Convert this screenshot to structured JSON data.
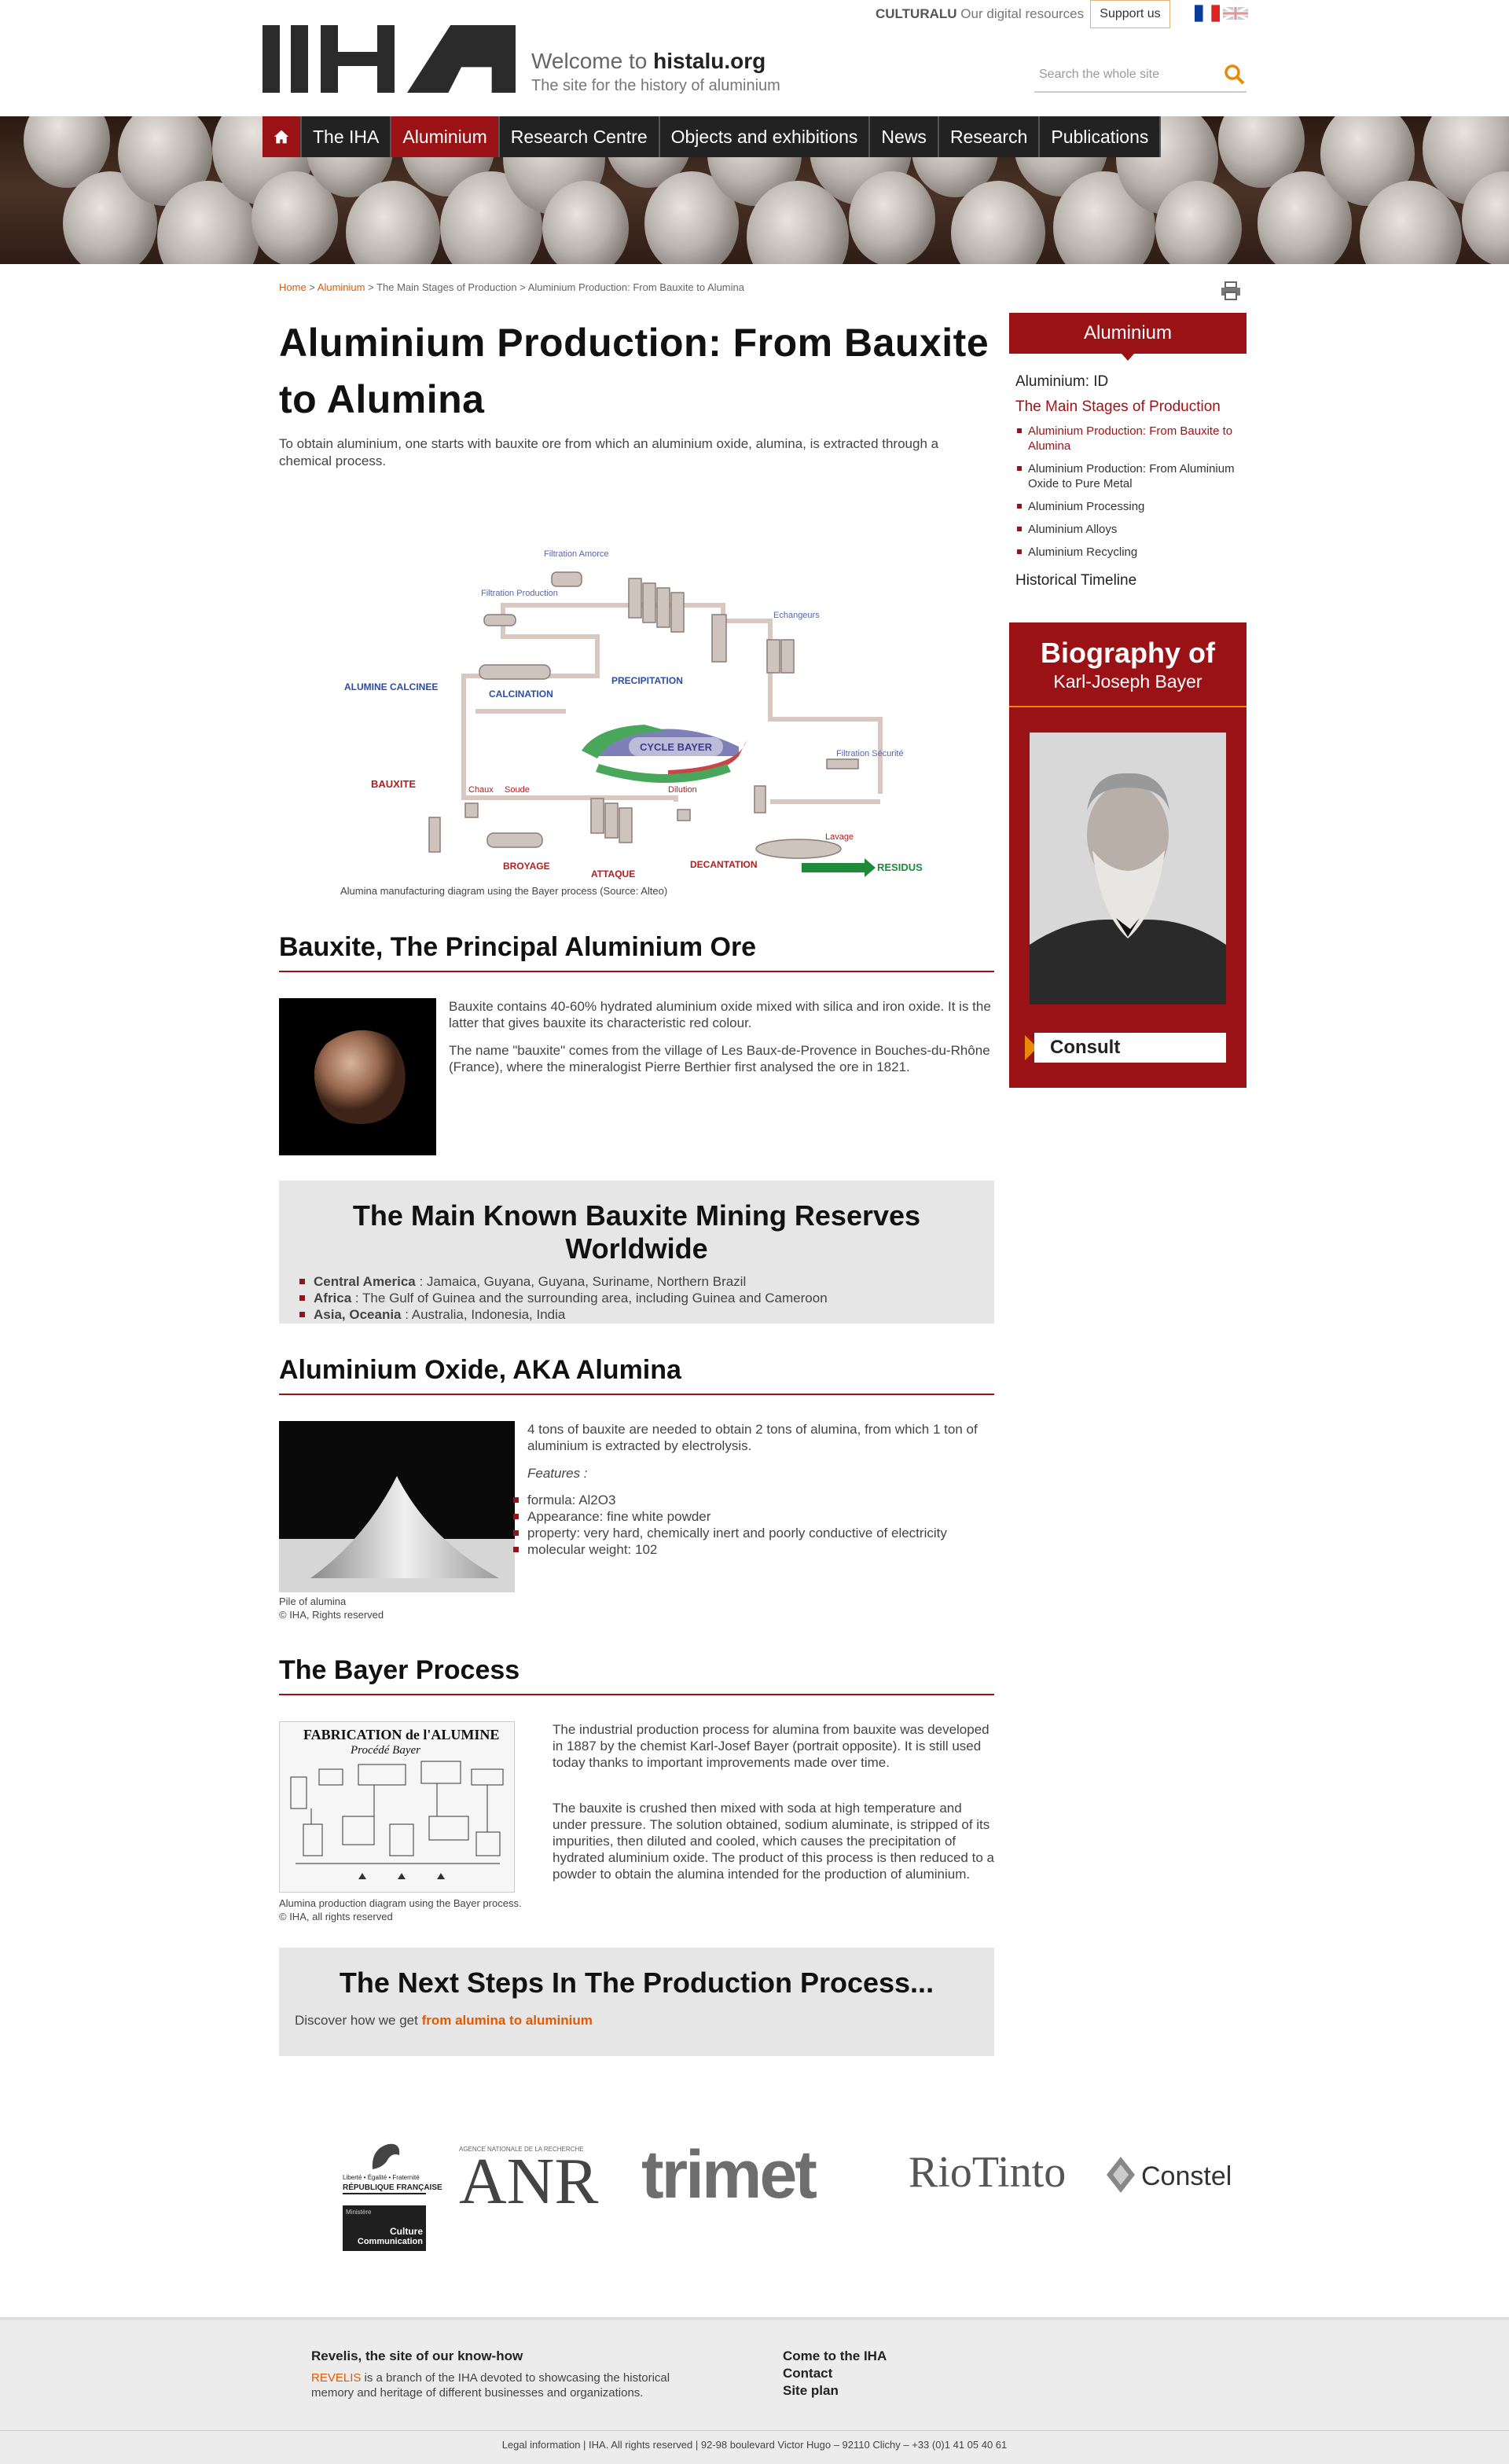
{
  "header": {
    "welcome_prefix": "Welcome to",
    "site_name": "histalu.org",
    "tagline": "The site for the history of aluminium",
    "culture_brand_bold": "CULTURALU",
    "culture_label": "Our digital resources",
    "support_label": "Support us",
    "search_placeholder": "Search the whole site",
    "flags": [
      "fr-flag",
      "uk-flag"
    ]
  },
  "nav": {
    "home_icon": "home-icon",
    "items": [
      "The IHA",
      "Aluminium",
      "Research Centre",
      "Objects and exhibitions",
      "News",
      "Research",
      "Publications"
    ],
    "active": "Aluminium"
  },
  "breadcrumb": {
    "home": "Home",
    "aluminium": "Aluminium",
    "stage": "The Main Stages of Production",
    "current": "Aluminium Production: From Bauxite to Alumina"
  },
  "page": {
    "title": "Aluminium Production: From Bauxite to Alumina",
    "intro": "To obtain aluminium, one starts with bauxite ore from which an aluminium oxide, alumina, is extracted through a chemical process.",
    "diagram_caption": "Alumina manufacturing diagram using the Bayer process (Source: Alteo)",
    "diagram_labels": {
      "filtration_amorce": "Filtration Amorce",
      "filtration_production": "Filtration Production",
      "echangeurs": "Echangeurs",
      "alumine": "ALUMINE CALCINEE",
      "calcination": "CALCINATION",
      "precipitation": "PRECIPITATION",
      "cycle": "CYCLE BAYER",
      "filtration_securite": "Filtration Sécurité",
      "bauxite": "BAUXITE",
      "chaux": "Chaux",
      "soude": "Soude",
      "dilution": "Dilution",
      "lavage": "Lavage",
      "broyage": "BROYAGE",
      "attaque": "ATTAQUE",
      "decantation": "DECANTATION",
      "residus": "RESIDUS"
    }
  },
  "bauxite_section": {
    "heading": "Bauxite, The Principal Aluminium Ore",
    "p1": "Bauxite contains 40-60% hydrated aluminium oxide mixed with silica and iron oxide. It is the latter that gives bauxite its characteristic red colour.",
    "p2": "The name \"bauxite\" comes from the village of Les Baux-de-Provence in Bouches-du-Rhône (France), where the mineralogist Pierre Berthier first analysed the ore in 1821."
  },
  "reserves_box": {
    "heading": "The Main Known Bauxite Mining Reserves Worldwide",
    "items": [
      {
        "region": "Central America",
        "places": " : Jamaica, Guyana, Guyana, Suriname, Northern Brazil"
      },
      {
        "region": "Africa",
        "places": " : The Gulf of Guinea and the surrounding area, including Guinea and Cameroon"
      },
      {
        "region": "Asia, Oceania",
        "places": " : Australia, Indonesia, India"
      }
    ]
  },
  "alumina_section": {
    "heading": "Aluminium Oxide, AKA Alumina",
    "p1": "4 tons of bauxite are needed to obtain 2 tons of alumina, from which 1 ton of aluminium is extracted by electrolysis.",
    "features_label": "Features :",
    "features": [
      "formula: Al2O3",
      "Appearance: fine white powder",
      "property: very hard, chemically inert and poorly conductive of electricity",
      "molecular weight: 102"
    ],
    "img_caption_1": "Pile of alumina",
    "img_caption_2": "© IHA, Rights reserved"
  },
  "bayer_section": {
    "heading": "The Bayer Process",
    "img_title_1": "FABRICATION de l'ALUMINE",
    "img_title_2": "Procédé Bayer",
    "p1": "The industrial production process for alumina from bauxite was developed in 1887 by the chemist Karl-Josef Bayer (portrait opposite). It is still used today thanks to important improvements made over time.",
    "p2": "The bauxite is crushed then mixed with soda at high temperature and under pressure. The solution obtained, sodium aluminate, is stripped of its impurities, then diluted and cooled, which causes the precipitation of hydrated aluminium oxide. The product of this process is then reduced to a powder to obtain the alumina intended for the production of aluminium.",
    "img_caption_1": "Alumina production diagram using the Bayer process.",
    "img_caption_2": "© IHA, all rights reserved"
  },
  "next_box": {
    "heading": "The Next Steps In The Production Process...",
    "text": "Discover how we get ",
    "link": "from alumina to aluminium"
  },
  "sidebar": {
    "heading": "Aluminium",
    "l1_id": "Aluminium: ID",
    "l1_stages": "The Main Stages of Production",
    "sub": [
      "Aluminium Production: From Bauxite to Alumina",
      "Aluminium Production: From Aluminium Oxide to Pure Metal",
      "Aluminium Processing",
      "Aluminium Alloys",
      "Aluminium Recycling"
    ],
    "timeline": "Historical Timeline",
    "bio_title": "Biography of",
    "bio_name": "Karl-Joseph Bayer",
    "consult": "Consult"
  },
  "sponsors": {
    "rf_top": "Liberté • Égalité • Fraternité",
    "rf": "RÉPUBLIQUE FRANÇAISE",
    "anr_small": "AGENCE NATIONALE DE LA RECHERCHE",
    "anr": "ANR",
    "trimet": "trimet",
    "riotinto": "RioTinto",
    "constel": "Constel",
    "culture_small": "Ministère",
    "culture": "Culture",
    "communication": "Communication"
  },
  "footer": {
    "revelis_heading": "Revelis, the site of our know-how",
    "revelis_link": "REVELIS",
    "revelis_text": " is a branch of the IHA devoted to showcasing the historical memory and heritage of different businesses and organizations.",
    "links": [
      "Come to the IHA",
      "Contact",
      "Site plan"
    ],
    "legal": "Legal information  |  IHA. All rights reserved  |  92-98 boulevard Victor Hugo – 92110 Clichy – +33 (0)1 41 05 40 61"
  },
  "colors": {
    "accent": "#9b1216",
    "orange": "#e8890c",
    "link": "#e05a00"
  }
}
